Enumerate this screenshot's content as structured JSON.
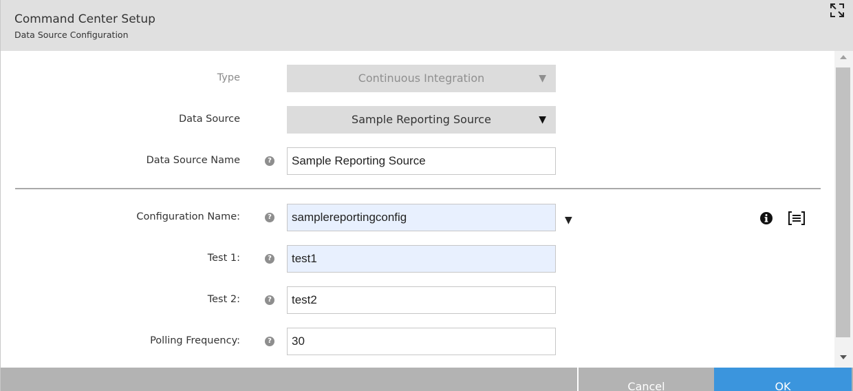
{
  "header": {
    "title": "Command Center Setup",
    "subtitle": "Data Source Configuration",
    "expand_icon": "expand-icon"
  },
  "form": {
    "type": {
      "label": "Type",
      "value": "Continuous Integration",
      "disabled": true
    },
    "data_source": {
      "label": "Data Source",
      "value": "Sample Reporting Source"
    },
    "data_source_name": {
      "label": "Data Source Name",
      "value": "Sample Reporting Source",
      "help_icon": "help-icon"
    },
    "configuration_name": {
      "label": "Configuration Name:",
      "value": "samplereportingconfig",
      "help_icon": "help-icon"
    },
    "test1": {
      "label": "Test 1:",
      "value": "test1",
      "help_icon": "help-icon"
    },
    "test2": {
      "label": "Test 2:",
      "value": "test2",
      "help_icon": "help-icon"
    },
    "polling_frequency": {
      "label": "Polling Frequency:",
      "value": "30",
      "help_icon": "help-icon"
    },
    "help_glyph": "?",
    "caret_glyph": "▼"
  },
  "actions": {
    "info_icon": "info-icon",
    "list_icon": "list-view-icon"
  },
  "footer": {
    "cancel_label": "Cancel",
    "ok_label": "OK"
  },
  "colors": {
    "header_bg": "#e0e0e0",
    "footer_bg": "#b3b3b3",
    "primary": "#3b95dd",
    "autofill_bg": "#e8f0fe"
  }
}
